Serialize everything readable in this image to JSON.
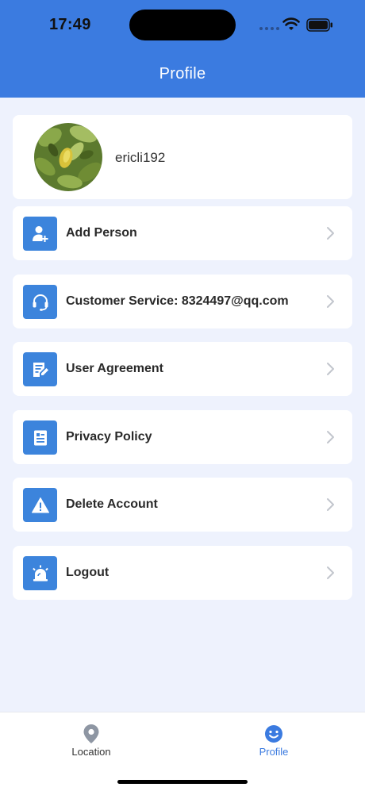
{
  "status_bar": {
    "time": "17:49"
  },
  "header": {
    "title": "Profile"
  },
  "profile": {
    "username": "ericli192"
  },
  "menu": [
    {
      "label": "Add Person",
      "icon": "add-person-icon"
    },
    {
      "label": "Customer Service: 8324497@qq.com",
      "icon": "headset-icon"
    },
    {
      "label": "User Agreement",
      "icon": "document-edit-icon"
    },
    {
      "label": "Privacy Policy",
      "icon": "document-list-icon"
    },
    {
      "label": "Delete Account",
      "icon": "warning-icon"
    },
    {
      "label": "Logout",
      "icon": "alarm-icon"
    }
  ],
  "tabbar": {
    "tabs": [
      {
        "label": "Location",
        "icon": "location-pin-icon",
        "active": false
      },
      {
        "label": "Profile",
        "icon": "smiley-icon",
        "active": true
      }
    ]
  },
  "colors": {
    "accent": "#3b7be0",
    "icon_bg": "#3c84dc",
    "background": "#eef2fd"
  }
}
